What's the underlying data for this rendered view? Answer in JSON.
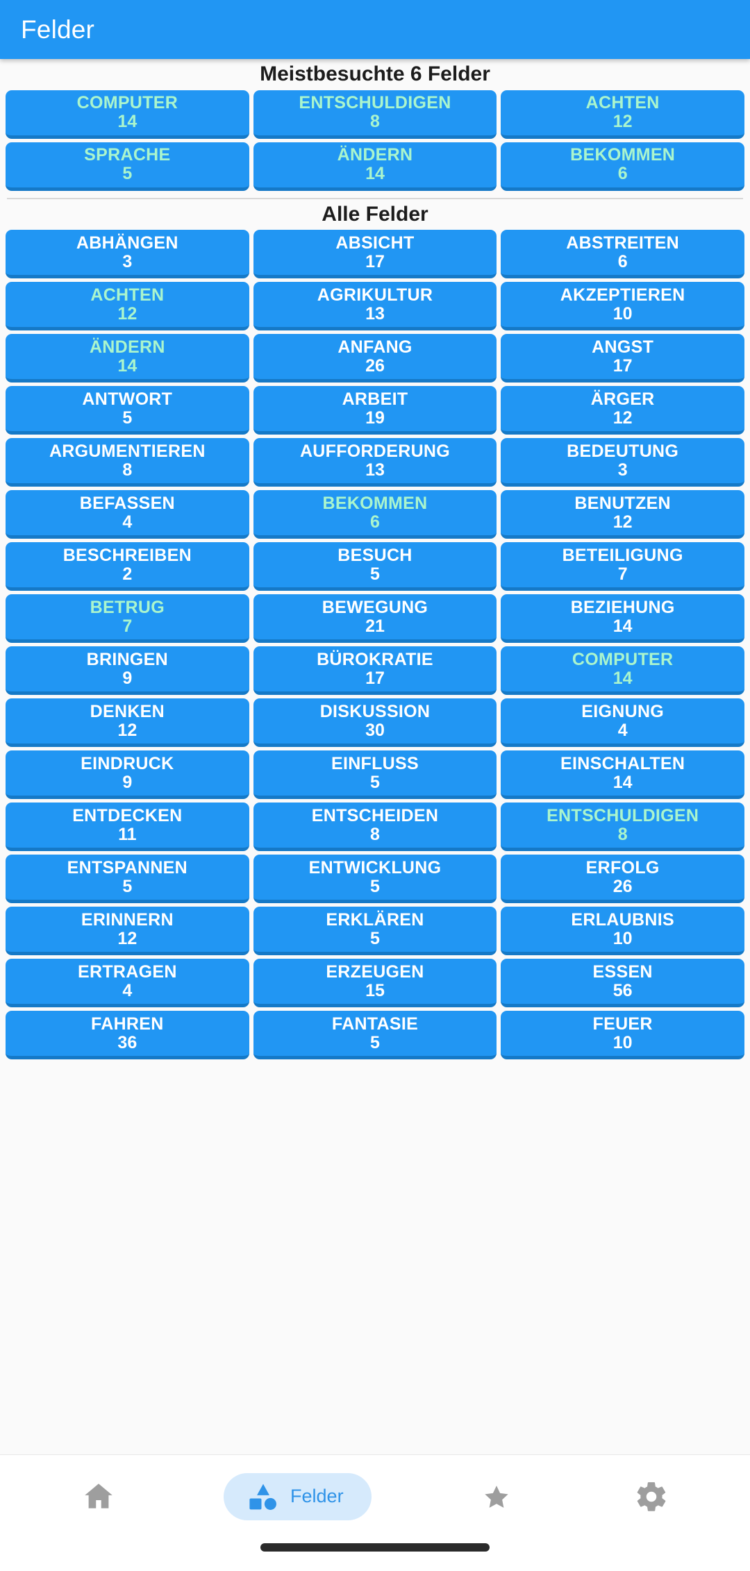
{
  "app": {
    "title": "Felder",
    "accent_color": "#2196f3",
    "tile_color": "#2196f3",
    "tile_border_color": "#1579c7",
    "tile_text_color": "#ffffff",
    "tile_highlight_text_color": "#aaf5cd",
    "background_color": "#fafafa"
  },
  "sections": {
    "most_visited": {
      "title": "Meistbesuchte 6 Felder",
      "items": [
        {
          "label": "COMPUTER",
          "count": "14",
          "highlighted": true
        },
        {
          "label": "ENTSCHULDIGEN",
          "count": "8",
          "highlighted": true
        },
        {
          "label": "ACHTEN",
          "count": "12",
          "highlighted": true
        },
        {
          "label": "SPRACHE",
          "count": "5",
          "highlighted": true
        },
        {
          "label": "ÄNDERN",
          "count": "14",
          "highlighted": true
        },
        {
          "label": "BEKOMMEN",
          "count": "6",
          "highlighted": true
        }
      ]
    },
    "all_fields": {
      "title": "Alle Felder",
      "items": [
        {
          "label": "ABHÄNGEN",
          "count": "3",
          "highlighted": false
        },
        {
          "label": "ABSICHT",
          "count": "17",
          "highlighted": false
        },
        {
          "label": "ABSTREITEN",
          "count": "6",
          "highlighted": false
        },
        {
          "label": "ACHTEN",
          "count": "12",
          "highlighted": true
        },
        {
          "label": "AGRIKULTUR",
          "count": "13",
          "highlighted": false
        },
        {
          "label": "AKZEPTIEREN",
          "count": "10",
          "highlighted": false
        },
        {
          "label": "ÄNDERN",
          "count": "14",
          "highlighted": true
        },
        {
          "label": "ANFANG",
          "count": "26",
          "highlighted": false
        },
        {
          "label": "ANGST",
          "count": "17",
          "highlighted": false
        },
        {
          "label": "ANTWORT",
          "count": "5",
          "highlighted": false
        },
        {
          "label": "ARBEIT",
          "count": "19",
          "highlighted": false
        },
        {
          "label": "ÄRGER",
          "count": "12",
          "highlighted": false
        },
        {
          "label": "ARGUMENTIEREN",
          "count": "8",
          "highlighted": false
        },
        {
          "label": "AUFFORDERUNG",
          "count": "13",
          "highlighted": false
        },
        {
          "label": "BEDEUTUNG",
          "count": "3",
          "highlighted": false
        },
        {
          "label": "BEFASSEN",
          "count": "4",
          "highlighted": false
        },
        {
          "label": "BEKOMMEN",
          "count": "6",
          "highlighted": true
        },
        {
          "label": "BENUTZEN",
          "count": "12",
          "highlighted": false
        },
        {
          "label": "BESCHREIBEN",
          "count": "2",
          "highlighted": false
        },
        {
          "label": "BESUCH",
          "count": "5",
          "highlighted": false
        },
        {
          "label": "BETEILIGUNG",
          "count": "7",
          "highlighted": false
        },
        {
          "label": "BETRUG",
          "count": "7",
          "highlighted": true
        },
        {
          "label": "BEWEGUNG",
          "count": "21",
          "highlighted": false
        },
        {
          "label": "BEZIEHUNG",
          "count": "14",
          "highlighted": false
        },
        {
          "label": "BRINGEN",
          "count": "9",
          "highlighted": false
        },
        {
          "label": "BÜROKRATIE",
          "count": "17",
          "highlighted": false
        },
        {
          "label": "COMPUTER",
          "count": "14",
          "highlighted": true
        },
        {
          "label": "DENKEN",
          "count": "12",
          "highlighted": false
        },
        {
          "label": "DISKUSSION",
          "count": "30",
          "highlighted": false
        },
        {
          "label": "EIGNUNG",
          "count": "4",
          "highlighted": false
        },
        {
          "label": "EINDRUCK",
          "count": "9",
          "highlighted": false
        },
        {
          "label": "EINFLUSS",
          "count": "5",
          "highlighted": false
        },
        {
          "label": "EINSCHALTEN",
          "count": "14",
          "highlighted": false
        },
        {
          "label": "ENTDECKEN",
          "count": "11",
          "highlighted": false
        },
        {
          "label": "ENTSCHEIDEN",
          "count": "8",
          "highlighted": false
        },
        {
          "label": "ENTSCHULDIGEN",
          "count": "8",
          "highlighted": true
        },
        {
          "label": "ENTSPANNEN",
          "count": "5",
          "highlighted": false
        },
        {
          "label": "ENTWICKLUNG",
          "count": "5",
          "highlighted": false
        },
        {
          "label": "ERFOLG",
          "count": "26",
          "highlighted": false
        },
        {
          "label": "ERINNERN",
          "count": "12",
          "highlighted": false
        },
        {
          "label": "ERKLÄREN",
          "count": "5",
          "highlighted": false
        },
        {
          "label": "ERLAUBNIS",
          "count": "10",
          "highlighted": false
        },
        {
          "label": "ERTRAGEN",
          "count": "4",
          "highlighted": false
        },
        {
          "label": "ERZEUGEN",
          "count": "15",
          "highlighted": false
        },
        {
          "label": "ESSEN",
          "count": "56",
          "highlighted": false
        },
        {
          "label": "FAHREN",
          "count": "36",
          "highlighted": false
        },
        {
          "label": "FANTASIE",
          "count": "5",
          "highlighted": false
        },
        {
          "label": "FEUER",
          "count": "10",
          "highlighted": false
        }
      ]
    }
  },
  "bottom_nav": {
    "items": [
      {
        "icon": "home-icon",
        "label": "",
        "active": false
      },
      {
        "icon": "shapes-icon",
        "label": "Felder",
        "active": true
      },
      {
        "icon": "star-icon",
        "label": "",
        "active": false
      },
      {
        "icon": "gear-icon",
        "label": "",
        "active": false
      }
    ],
    "active_color": "#2f93e8",
    "active_pill_color": "#d6eafc",
    "inactive_color": "#9e9e9e"
  }
}
